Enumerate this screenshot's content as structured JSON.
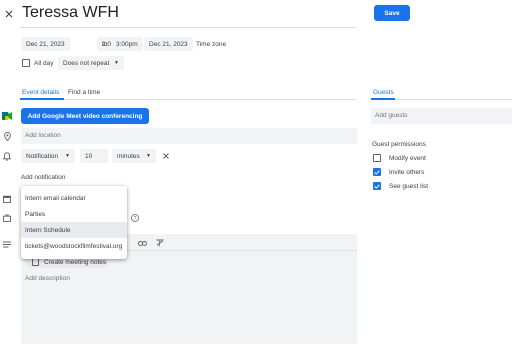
{
  "header": {
    "title": "Teressa WFH",
    "save_label": "Save"
  },
  "datetime": {
    "start_date": "Dec 21, 2023",
    "start_time": "2:00pm",
    "separator": "to",
    "end_time": "3:00pm",
    "end_date": "Dec 21, 2023",
    "timezone_label": "Time zone"
  },
  "allday": {
    "label": "All day",
    "checked": false,
    "repeat_value": "Does not repeat"
  },
  "tabs": [
    {
      "label": "Event details",
      "active": true
    },
    {
      "label": "Find a time",
      "active": false
    }
  ],
  "conferencing": {
    "button_label": "Add Google Meet video conferencing"
  },
  "location": {
    "placeholder": "Add location"
  },
  "notification": {
    "type": "Notification",
    "amount": "10",
    "unit": "minutes"
  },
  "add_notification_label": "Add notification",
  "calendar_menu": {
    "items": [
      {
        "label": "Intern email calendar",
        "highlighted": false
      },
      {
        "label": "Parties",
        "highlighted": false
      },
      {
        "label": "Intern Schedule",
        "highlighted": true
      },
      {
        "label": "tickets@woodstockfilmfestival.org",
        "highlighted": false
      }
    ]
  },
  "description": {
    "meeting_notes_label": "Create meeting notes",
    "placeholder": "Add description"
  },
  "guests": {
    "tab_label": "Guests",
    "input_placeholder": "Add guests",
    "permissions_title": "Guest permissions",
    "permissions": [
      {
        "label": "Modify event",
        "checked": false
      },
      {
        "label": "Invite others",
        "checked": true
      },
      {
        "label": "See guest list",
        "checked": true
      }
    ]
  },
  "colors": {
    "accent": "#1a73e8",
    "chip_bg": "#f1f3f4",
    "menu_highlight": "#e8eaed"
  },
  "icons": [
    "close-icon",
    "meet-icon",
    "location-icon",
    "bell-icon",
    "calendar-icon",
    "briefcase-icon",
    "menu-lines-icon",
    "help-icon",
    "link-icon",
    "clear-format-icon",
    "chevron-down-icon",
    "close-small-icon"
  ]
}
